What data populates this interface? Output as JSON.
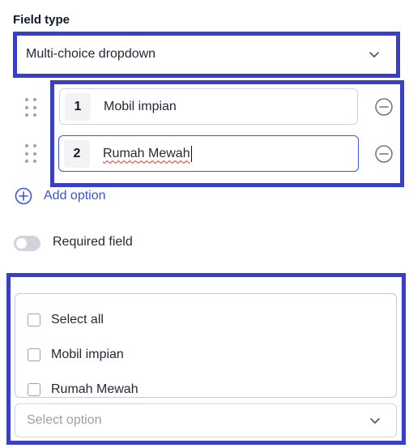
{
  "field_type": {
    "label": "Field type",
    "selected": "Multi-choice dropdown"
  },
  "options": [
    {
      "number": "1",
      "value": "Mobil impian"
    },
    {
      "number": "2",
      "value": "Rumah Mewah"
    }
  ],
  "add_option_label": "Add option",
  "required": {
    "label": "Required field",
    "enabled": false
  },
  "preview": {
    "items": [
      "Select all",
      "Mobil impian",
      "Rumah Mewah"
    ],
    "placeholder": "Select option"
  },
  "colors": {
    "highlight": "#3a3fc7",
    "accent": "#3a56d4"
  }
}
